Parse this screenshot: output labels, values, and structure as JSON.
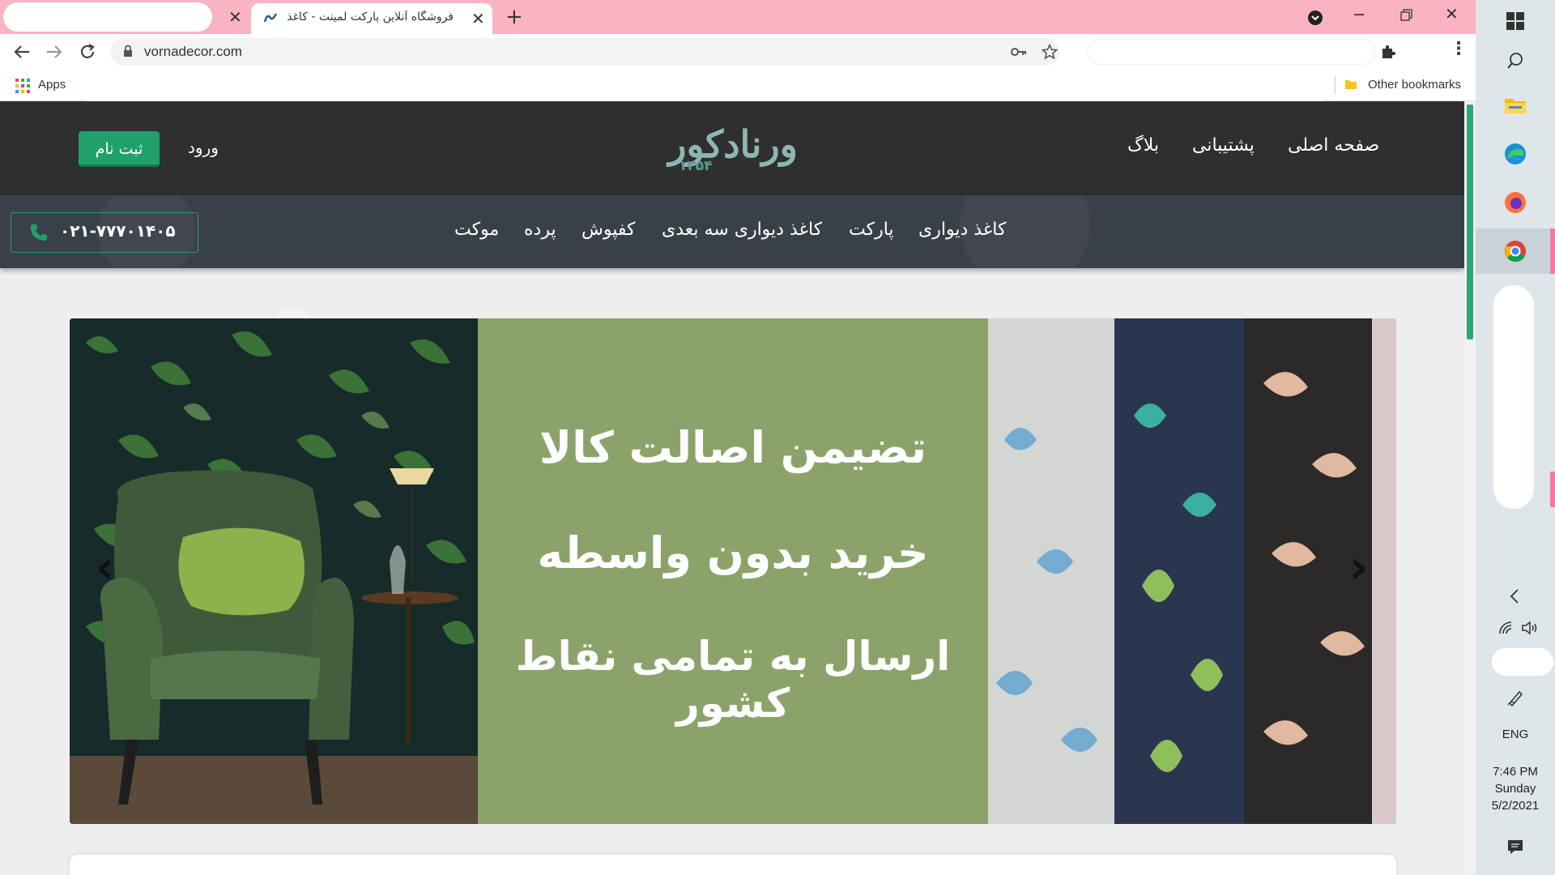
{
  "browser": {
    "tab_title": "فروشگاه آنلاین پارکت لمینت - کاغذ",
    "url": "vornadecor.com",
    "bookmarks_apps": "Apps",
    "other_bookmarks": "Other bookmarks"
  },
  "header": {
    "nav_items": [
      "صفحه اصلی",
      "پشتیبانی",
      "بلاگ"
    ],
    "logo_text": "ورنادکور",
    "logo_year": "۱۳۵۴",
    "login": "ورود",
    "register": "ثبت نام"
  },
  "categories": [
    "کاغذ دیواری",
    "پارکت",
    "کاغذ دیواری سه بعدی",
    "کفپوش",
    "پرده",
    "موکت"
  ],
  "phone": "۰۲۱-۷۷۷۰۱۴۰۵",
  "slider": {
    "lines": [
      "تضیمن اصالت کالا",
      "خرید بدون واسطه",
      "ارسال به تمامی نقاط کشور"
    ]
  },
  "taskbar": {
    "language": "ENG",
    "time": "7:46 PM",
    "day": "Sunday",
    "date": "5/2/2021"
  },
  "colors": {
    "tabstrip": "#f9b3c3",
    "header_bg": "#2f2f2f",
    "accent_green": "#22a06b",
    "slide_green": "#8ba36a"
  }
}
